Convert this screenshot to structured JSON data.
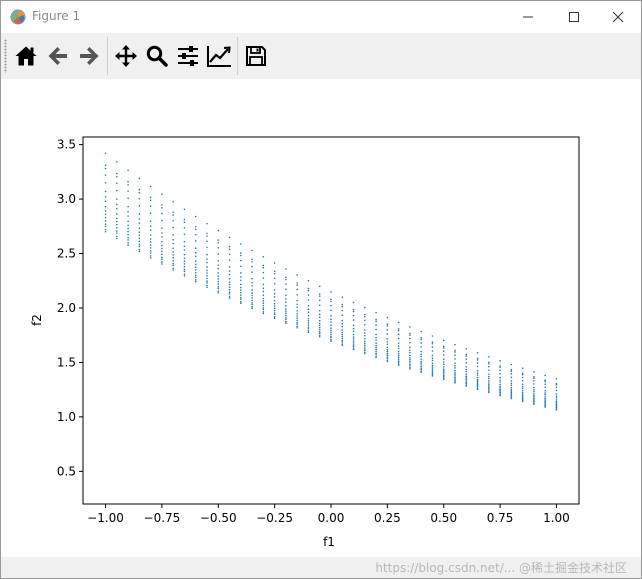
{
  "window": {
    "title": "Figure 1"
  },
  "toolbar": {
    "buttons": [
      {
        "name": "home",
        "icon": "home-icon"
      },
      {
        "name": "back",
        "icon": "arrow-left-icon"
      },
      {
        "name": "forward",
        "icon": "arrow-right-icon"
      },
      {
        "name": "pan",
        "icon": "move-icon"
      },
      {
        "name": "zoom",
        "icon": "magnifier-icon"
      },
      {
        "name": "configure-subplots",
        "icon": "sliders-icon"
      },
      {
        "name": "edit-axis",
        "icon": "line-chart-icon"
      },
      {
        "name": "save",
        "icon": "floppy-disk-icon"
      }
    ]
  },
  "colors": {
    "marker": "#1f77b4",
    "toolbar_bg": "#f0f0f0"
  },
  "chart_data": {
    "type": "scatter",
    "xlabel": "f1",
    "ylabel": "f2",
    "xlim": [
      -1.1,
      1.1
    ],
    "ylim": [
      0.2,
      3.57
    ],
    "xticks": [
      "−1.00",
      "−0.75",
      "−0.50",
      "−0.25",
      "0.00",
      "0.25",
      "0.50",
      "0.75",
      "1.00"
    ],
    "xtick_values": [
      -1.0,
      -0.75,
      -0.5,
      -0.25,
      0.0,
      0.25,
      0.5,
      0.75,
      1.0
    ],
    "yticks": [
      "0.5",
      "1.0",
      "1.5",
      "2.0",
      "2.5",
      "3.0",
      "3.5"
    ],
    "ytick_values": [
      0.5,
      1.0,
      1.5,
      2.0,
      2.5,
      3.0,
      3.5
    ],
    "x_range": [
      -1.0,
      1.0
    ],
    "x_points_per_curve": 41,
    "curve_family": "f2 = A * exp(-0.465 * (f1 + 1))",
    "curve_amplitudes": [
      3.42,
      3.31,
      3.28,
      3.22,
      3.15,
      3.07,
      3.02,
      2.98,
      2.93,
      2.89,
      2.86,
      2.83,
      2.8,
      2.77,
      2.75,
      2.72,
      2.7
    ],
    "grid": false,
    "marker_size": 0.8
  },
  "watermark": "https://blog.csdn.net/...  @稀土掘金技术社区"
}
